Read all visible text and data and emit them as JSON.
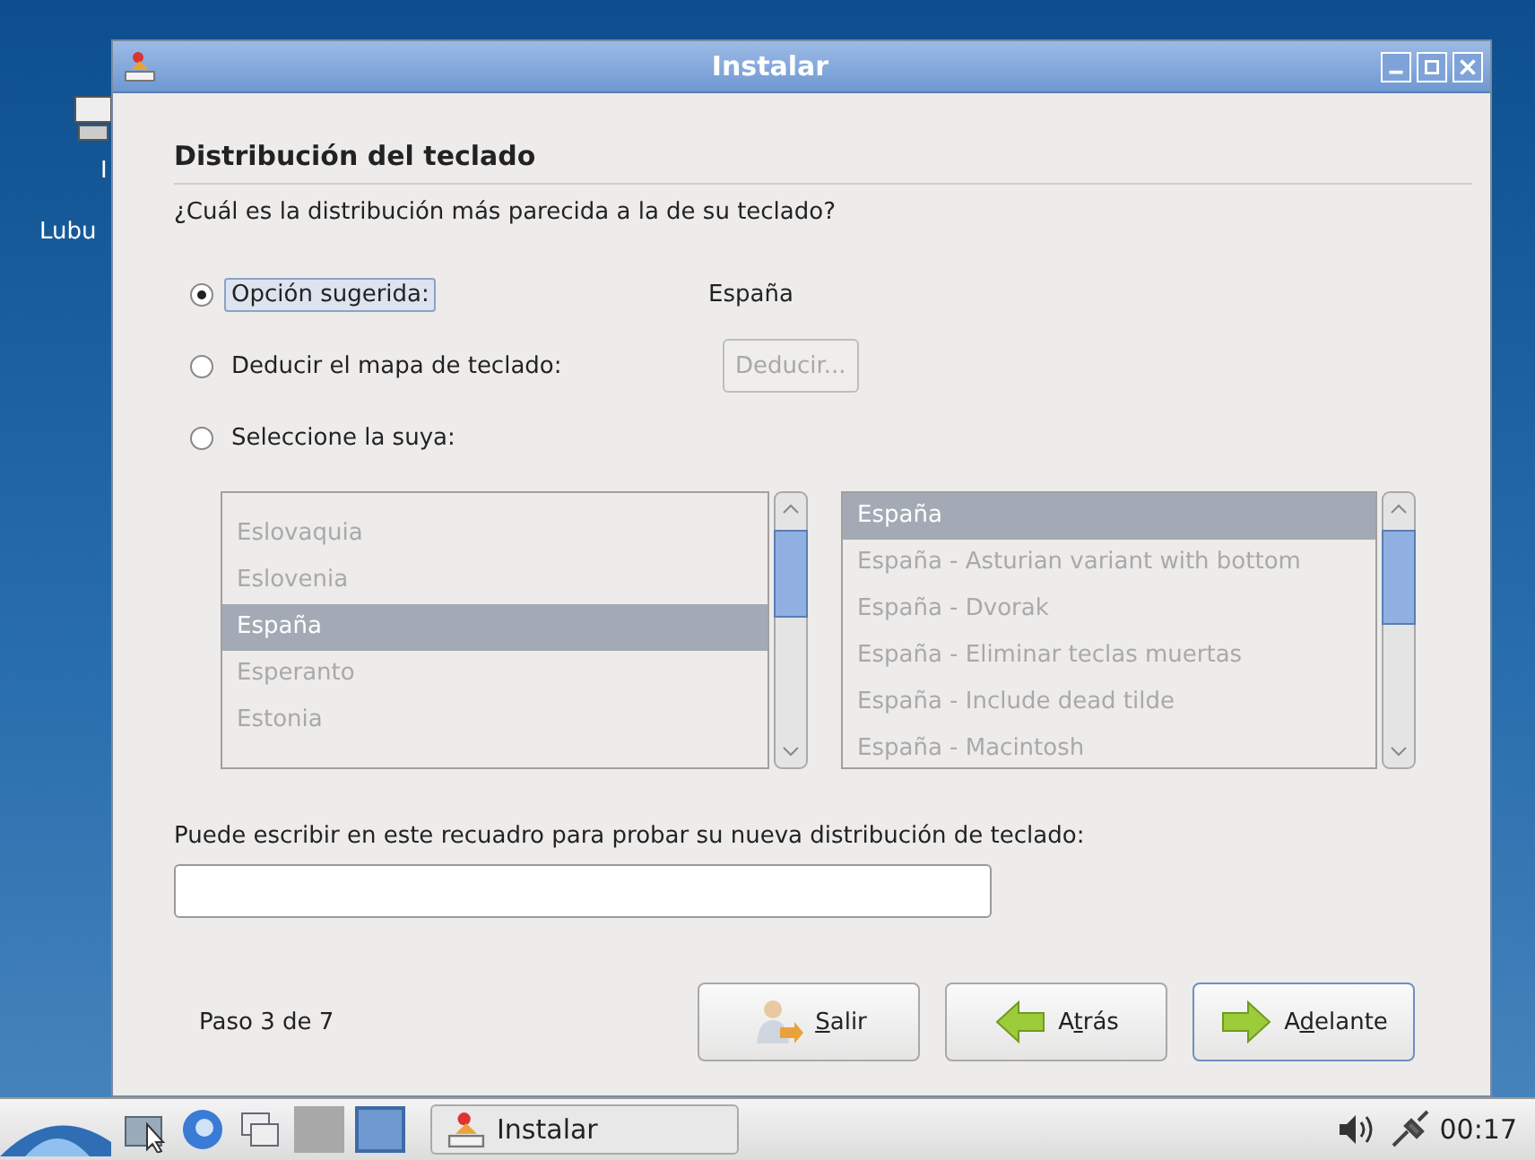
{
  "desktop": {
    "icon_label_lines": [
      "I",
      "Lubu"
    ]
  },
  "window": {
    "title": "Instalar"
  },
  "page": {
    "heading": "Distribución del teclado",
    "question": "¿Cuál es la distribución más parecida a la de su teclado?"
  },
  "options": [
    {
      "kind": "value",
      "label": "Opción sugerida:",
      "selected": true,
      "focused": true,
      "value": "España"
    },
    {
      "kind": "button",
      "label": "Deducir el mapa de teclado:",
      "selected": false,
      "focused": false,
      "button": {
        "label": "Deducir...",
        "disabled": true
      }
    },
    {
      "kind": "plain",
      "label": "Seleccione la suya:",
      "selected": false,
      "focused": false
    }
  ],
  "layouts": {
    "disabled": true,
    "items": [
      {
        "label": "Eslovaquia",
        "selected": false
      },
      {
        "label": "Eslovenia",
        "selected": false
      },
      {
        "label": "España",
        "selected": true
      },
      {
        "label": "Esperanto",
        "selected": false
      },
      {
        "label": "Estonia",
        "selected": false
      }
    ]
  },
  "variants": {
    "disabled": true,
    "items": [
      {
        "label": "España",
        "selected": true
      },
      {
        "label": "España - Asturian variant with bottom",
        "selected": false
      },
      {
        "label": "España - Dvorak",
        "selected": false
      },
      {
        "label": "España - Eliminar teclas muertas",
        "selected": false
      },
      {
        "label": "España - Include dead tilde",
        "selected": false
      },
      {
        "label": "España - Macintosh",
        "selected": false
      }
    ]
  },
  "test": {
    "prompt": "Puede escribir en este recuadro para probar su nueva distribución de teclado:"
  },
  "footer": {
    "step": "Paso 3 de 7",
    "buttons": [
      {
        "kind": "exit",
        "label_parts": [
          {
            "text": "S",
            "underlined": true
          },
          {
            "text": "alir",
            "underlined": false
          }
        ],
        "focused": false
      },
      {
        "kind": "back",
        "label_parts": [
          {
            "text": "A",
            "underlined": false
          },
          {
            "text": "t",
            "underlined": true
          },
          {
            "text": "rás",
            "underlined": false
          }
        ],
        "focused": false
      },
      {
        "kind": "forward",
        "label_parts": [
          {
            "text": "A",
            "underlined": false
          },
          {
            "text": "d",
            "underlined": true
          },
          {
            "text": "elante",
            "underlined": false
          }
        ],
        "focused": true
      }
    ]
  },
  "taskbar": {
    "workspaces": [
      {
        "selected": false
      },
      {
        "selected": true
      }
    ],
    "tasks": [
      {
        "label": "Instalar",
        "selected": false
      }
    ],
    "clock": "00:17"
  }
}
